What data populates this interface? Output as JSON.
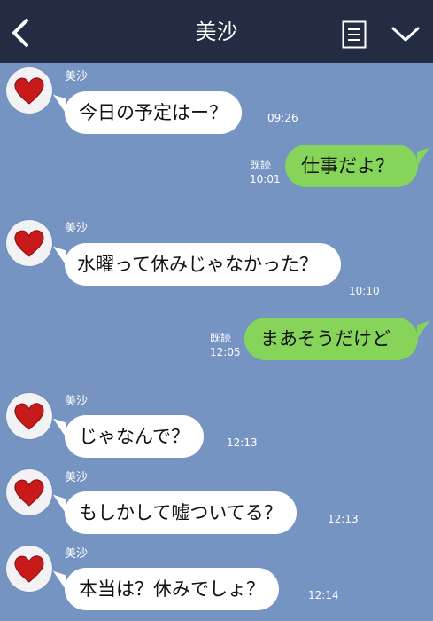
{
  "header": {
    "title": "美沙"
  },
  "messages": [
    {
      "sender": "美沙",
      "text": "今日の予定はー？",
      "time": "09:26"
    },
    {
      "read": "既読",
      "text": "仕事だよ？",
      "time": "10:01"
    },
    {
      "sender": "美沙",
      "text": "水曜って休みじゃなかった？",
      "time": "10:10"
    },
    {
      "read": "既読",
      "text": "まあそうだけど",
      "time": "12:05"
    },
    {
      "sender": "美沙",
      "text": "じゃなんで？",
      "time": "12:13"
    },
    {
      "sender": "美沙",
      "text": "もしかして嘘ついてる？",
      "time": "12:13"
    },
    {
      "sender": "美沙",
      "text": "本当は？休みでしょ？",
      "time": "12:14"
    }
  ],
  "colors": {
    "header_bg": "#232c42",
    "chat_bg": "#7594c1",
    "sent_bubble": "#86d45a",
    "received_bubble": "#ffffff",
    "avatar_heart": "#c81a1a"
  }
}
